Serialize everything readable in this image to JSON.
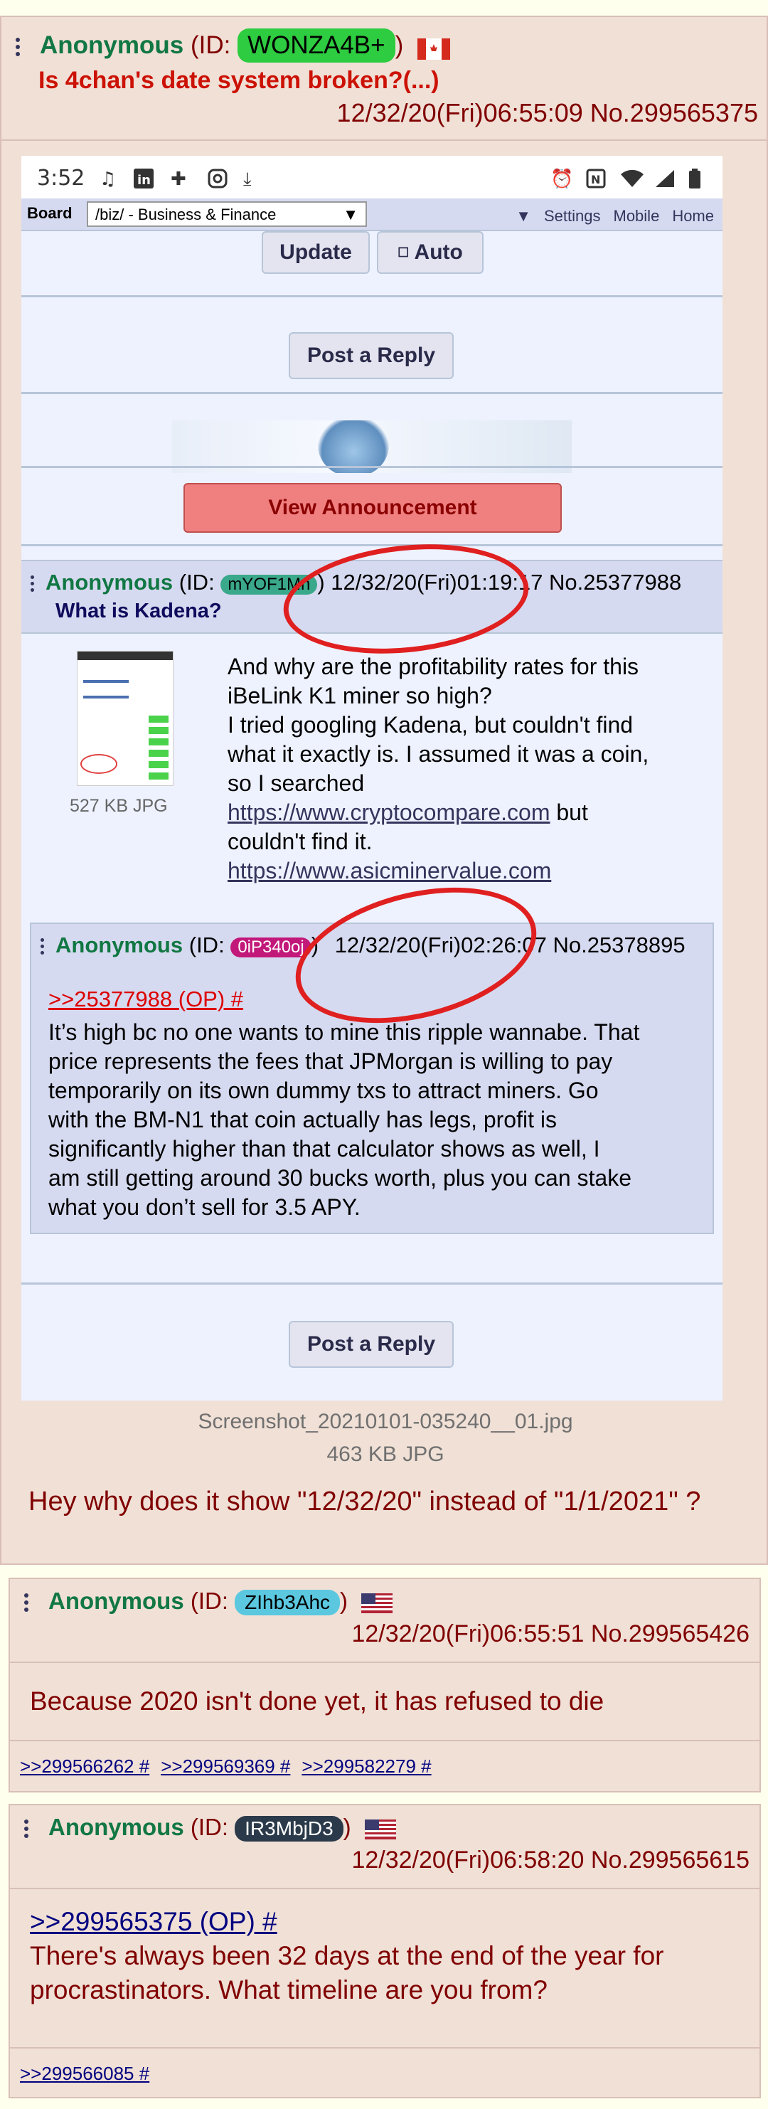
{
  "op": {
    "name": "Anonymous",
    "id_prefix": "(ID: ",
    "id": "WONZA4B+",
    "id_suffix": ")",
    "id_color": "#2ecc40",
    "flag": "canada-flag-icon",
    "subject": "Is 4chan's date system broken?(...)",
    "datetime": "12/32/20(Fri)06:55:09",
    "post_no": "No.299565375",
    "file_name": "Screenshot_20210101-035240__01.jpg",
    "file_info": "463 KB JPG",
    "comment": "Hey why does it show \"12/32/20\" instead of \"1/1/2021\" ?"
  },
  "screenshot": {
    "status": {
      "time": "3:52",
      "left_icons": [
        "music-icon",
        "linkedin-icon",
        "puzzle-icon",
        "instagram-icon",
        "download-icon"
      ],
      "right_icons": [
        "alarm-icon",
        "nfc-icon",
        "wifi-icon",
        "signal-icon",
        "battery-icon"
      ]
    },
    "board_label": "Board",
    "board_select": "/biz/ - Business & Finance",
    "nav_links": [
      "Settings",
      "Mobile",
      "Home"
    ],
    "update_label": "Update",
    "auto_label": "Auto",
    "post_reply_label": "Post a Reply",
    "announcement_label": "View Announcement",
    "reply1": {
      "name": "Anonymous",
      "id": "mYOF1Mn",
      "datetime": "12/32/20(Fri)01:19:17",
      "post_no": "No.25377988",
      "subject": "What is Kadena?",
      "file_info": "527 KB JPG",
      "lines": [
        "And why are the profitability rates for this",
        "iBeLink K1 miner so high?",
        "I tried googling Kadena, but couldn't find",
        "what it exactly is. I assumed it was a coin,",
        "so I searched"
      ],
      "link1": "https://www.cryptocompare.com",
      "link1_after": " but",
      "line_after": "couldn't find it.",
      "link2": "https://www.asicminervalue.com"
    },
    "reply2": {
      "name": "Anonymous",
      "id": "0iP340oj",
      "datetime": "12/32/20(Fri)02:26:07",
      "post_no": "No.25378895",
      "quote": ">>25377988 (OP) #",
      "lines": [
        "It’s high bc no one wants to mine this ripple wannabe. That",
        "price represents the fees that JPMorgan is willing to pay",
        "temporarily on its own dummy txs to attract miners. Go",
        "with the BM-N1 that coin actually has legs, profit is",
        "significantly higher than that calculator shows as well, I",
        "am still getting around 30 bucks worth, plus you can stake",
        "what you don’t sell for 3.5 APY."
      ]
    }
  },
  "replies": [
    {
      "name": "Anonymous",
      "id": "ZIhb3Ahc",
      "id_color": "#5bc8e0",
      "flag": "usa-flag-icon",
      "datetime": "12/32/20(Fri)06:55:51",
      "post_no": "No.299565426",
      "text": "Because 2020 isn't done yet, it has refused to die",
      "backlinks": [
        ">>299566262 #",
        ">>299569369 #",
        ">>299582279 #"
      ]
    },
    {
      "name": "Anonymous",
      "id": "IR3MbjD3",
      "id_color": "#2b3a4a",
      "flag": "usa-flag-icon",
      "datetime": "12/32/20(Fri)06:58:20",
      "post_no": "No.299565615",
      "quote": ">>299565375 (OP) #",
      "lines": [
        "There's always been 32 days at the end of the year for",
        "procrastinators. What timeline are you from?"
      ],
      "backlinks": [
        ">>299566085 #"
      ]
    }
  ]
}
